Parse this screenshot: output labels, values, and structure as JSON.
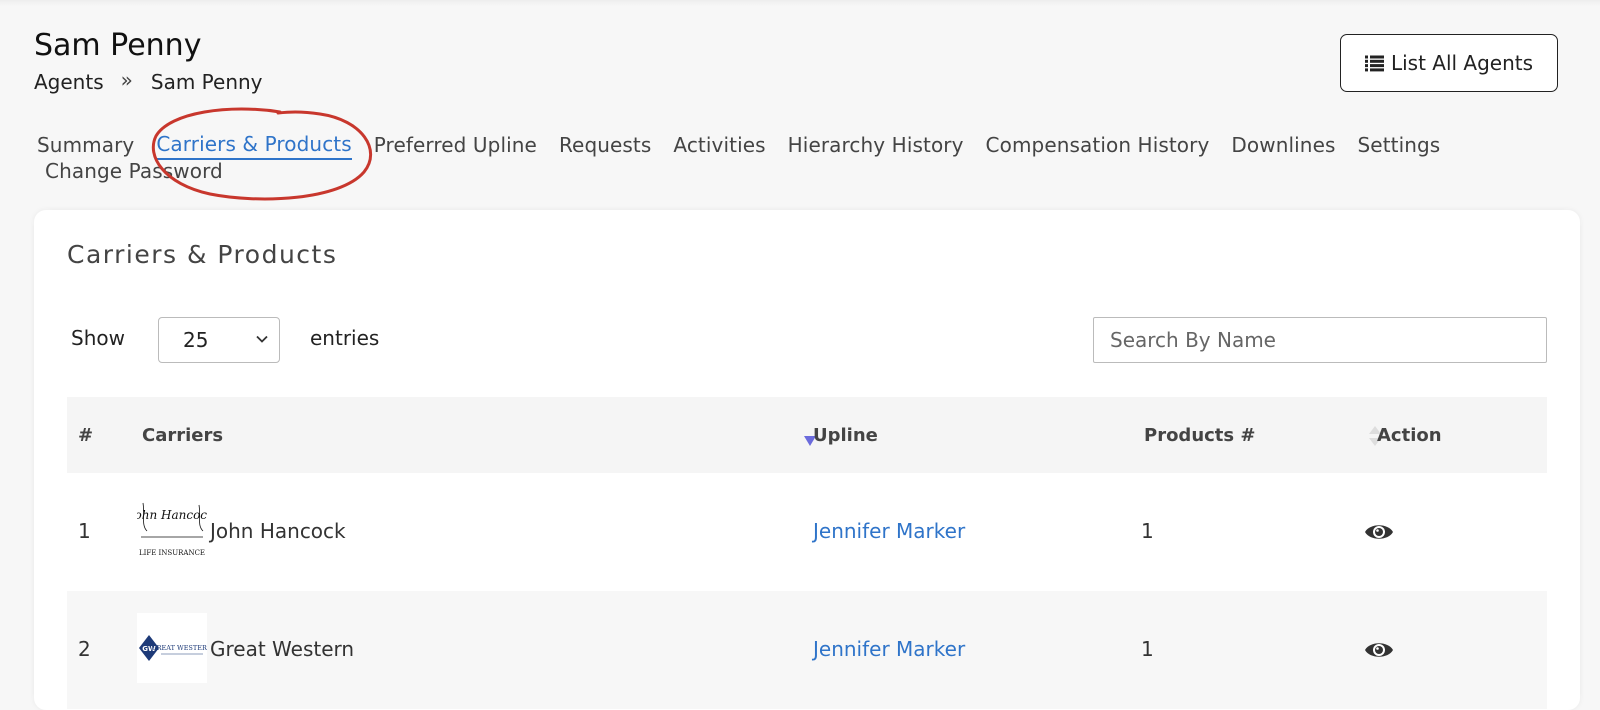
{
  "header": {
    "title": "Sam Penny",
    "breadcrumb": [
      "Agents",
      "Sam Penny"
    ],
    "breadcrumb_separator": "»",
    "list_all_agents_label": "List All Agents"
  },
  "tabs": {
    "row1": [
      {
        "label": "Summary",
        "active": false
      },
      {
        "label": "Carriers & Products",
        "active": true
      },
      {
        "label": "Preferred Upline",
        "active": false
      },
      {
        "label": "Requests",
        "active": false
      },
      {
        "label": "Activities",
        "active": false
      },
      {
        "label": "Hierarchy History",
        "active": false
      },
      {
        "label": "Compensation History",
        "active": false
      },
      {
        "label": "Downlines",
        "active": false
      },
      {
        "label": "Settings",
        "active": false
      }
    ],
    "row2": [
      {
        "label": "Change Password",
        "active": false
      }
    ]
  },
  "card": {
    "title": "Carriers & Products",
    "show_label": "Show",
    "entries_value": "25",
    "entries_label": "entries",
    "search_placeholder": "Search By Name"
  },
  "table": {
    "headers": [
      "#",
      "Carriers",
      "Upline",
      "Products #",
      "Action"
    ],
    "rows": [
      {
        "num": "1",
        "carrier": "John Hancock",
        "upline": "Jennifer Marker",
        "products": "1",
        "logo_icon": "john-hancock-logo-icon",
        "logo_text": [
          "John Hancock",
          "LIFE INSURANCE"
        ]
      },
      {
        "num": "2",
        "carrier": "Great Western",
        "upline": "Jennifer Marker",
        "products": "1",
        "logo_icon": "great-western-logo-icon",
        "logo_text": [
          "GW",
          "GREAT WESTERN"
        ]
      }
    ]
  },
  "colors": {
    "accent": "#2f74c9",
    "annotation_red": "#c8372d",
    "sort_active": "#6b6bdc"
  }
}
